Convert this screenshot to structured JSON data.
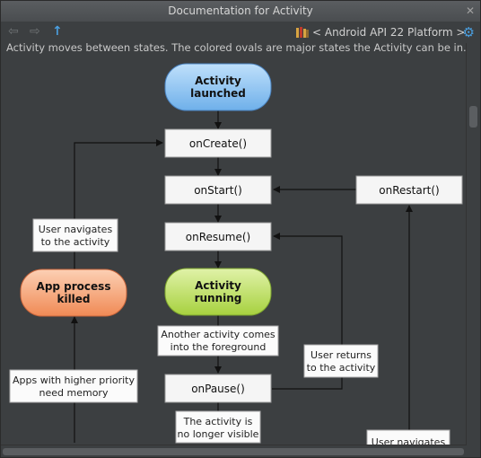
{
  "window": {
    "title": "Documentation for Activity",
    "pin_icon": "pin-icon"
  },
  "toolbar": {
    "back_icon": "back-arrow-icon",
    "forward_icon": "forward-arrow-icon",
    "up_icon": "up-arrow-icon",
    "platform_label": "< Android API 22 Platform >",
    "settings_icon": "gear-icon"
  },
  "content": {
    "intro": "Activity moves between states. The colored ovals are major states the Activity can be in."
  },
  "diagram": {
    "states": {
      "launched": [
        "Activity",
        "launched"
      ],
      "running": [
        "Activity",
        "running"
      ],
      "killed": [
        "App process",
        "killed"
      ]
    },
    "methods": {
      "oncreate": "onCreate()",
      "onstart": "onStart()",
      "onrestart": "onRestart()",
      "onresume": "onResume()",
      "onpause": "onPause()"
    },
    "notes": {
      "navigates": [
        "User navigates",
        "to the activity"
      ],
      "foreground": [
        "Another activity comes",
        "into the foreground"
      ],
      "returns": [
        "User returns",
        "to the activity"
      ],
      "priority": [
        "Apps with higher priority",
        "need memory"
      ],
      "not_visible": [
        "The activity is",
        "no longer visible"
      ],
      "navigates2": "User navigates"
    }
  },
  "colors": {
    "launched": "#8cc2f0",
    "running": "#b8dc64",
    "killed": "#f4a57a",
    "background": "#3c3f41"
  }
}
